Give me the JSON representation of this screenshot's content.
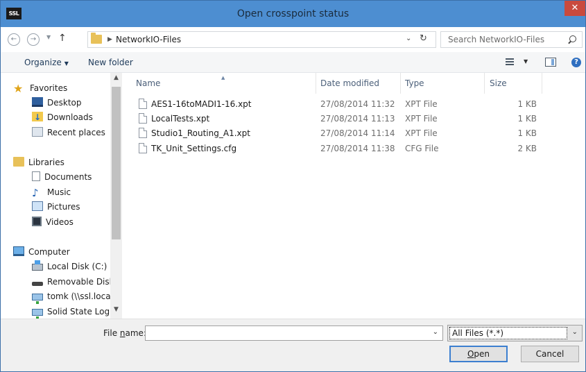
{
  "window": {
    "title": "Open crosspoint status",
    "app_logo": "SSL",
    "close_glyph": "✕"
  },
  "nav": {
    "back_glyph": "←",
    "forward_glyph": "→",
    "up_glyph": "↑",
    "breadcrumb": "NetworkIO-Files",
    "search_placeholder": "Search NetworkIO-Files"
  },
  "toolbar": {
    "organize_label": "Organize",
    "new_folder_label": "New folder",
    "help_glyph": "?"
  },
  "sidebar": {
    "favorites": {
      "label": "Favorites",
      "items": [
        "Desktop",
        "Downloads",
        "Recent places"
      ]
    },
    "libraries": {
      "label": "Libraries",
      "items": [
        "Documents",
        "Music",
        "Pictures",
        "Videos"
      ]
    },
    "computer": {
      "label": "Computer",
      "items": [
        "Local Disk (C:)",
        "Removable Disk (",
        "tomk (\\\\ssl.local\\",
        "Solid State Logic"
      ]
    }
  },
  "columns": {
    "name": "Name",
    "date": "Date modified",
    "type": "Type",
    "size": "Size"
  },
  "files": [
    {
      "name": "AES1-16toMADI1-16.xpt",
      "date": "27/08/2014 11:32",
      "type": "XPT File",
      "size": "1 KB"
    },
    {
      "name": "LocalTests.xpt",
      "date": "27/08/2014 11:13",
      "type": "XPT File",
      "size": "1 KB"
    },
    {
      "name": "Studio1_Routing_A1.xpt",
      "date": "27/08/2014 11:14",
      "type": "XPT File",
      "size": "1 KB"
    },
    {
      "name": "TK_Unit_Settings.cfg",
      "date": "27/08/2014 11:38",
      "type": "CFG File",
      "size": "2 KB"
    }
  ],
  "bottom": {
    "filename_label_prefix": "File ",
    "filename_label_accel": "n",
    "filename_label_suffix": "ame:",
    "filename_value": "",
    "filter_value": "All Files (*.*)",
    "open_accel": "O",
    "open_rest": "pen",
    "cancel_label": "Cancel"
  },
  "colors": {
    "titlebar": "#4d8ed1",
    "close": "#c94a3e",
    "accent": "#3c7fd0"
  }
}
